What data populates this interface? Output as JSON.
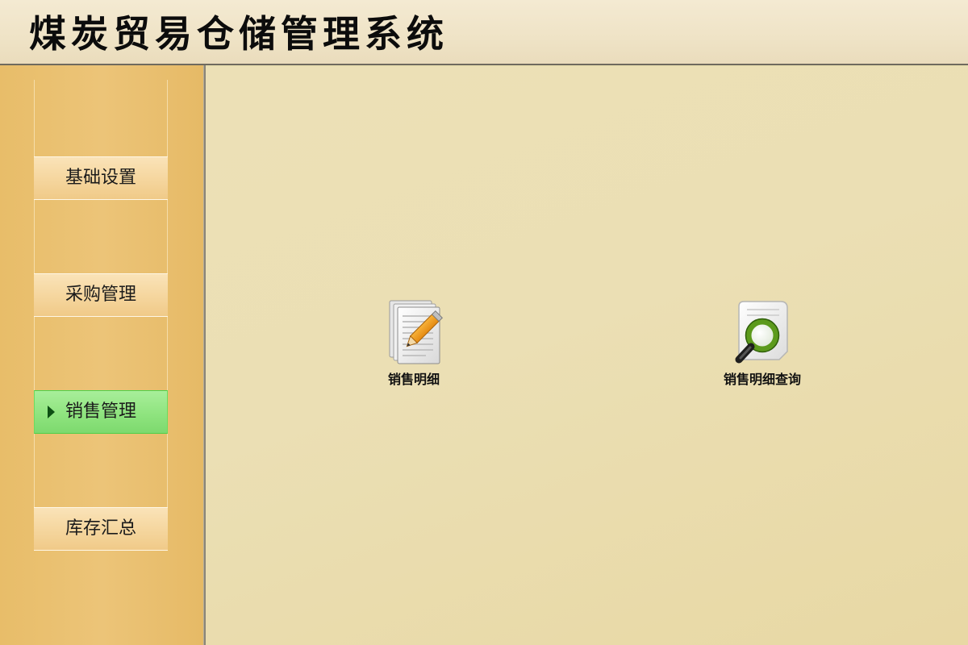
{
  "header": {
    "title": "煤炭贸易仓储管理系统"
  },
  "sidebar": {
    "items": [
      {
        "label": "基础设置",
        "active": false
      },
      {
        "label": "采购管理",
        "active": false
      },
      {
        "label": "销售管理",
        "active": true
      },
      {
        "label": "库存汇总",
        "active": false
      }
    ]
  },
  "main": {
    "functions": [
      {
        "label": "销售明细",
        "icon": "edit-document-icon"
      },
      {
        "label": "销售明细查询",
        "icon": "document-search-icon"
      }
    ]
  },
  "colors": {
    "active_nav": "#8fe47f",
    "sidebar": "#e8bd69",
    "main_bg": "#ebdfb4"
  }
}
